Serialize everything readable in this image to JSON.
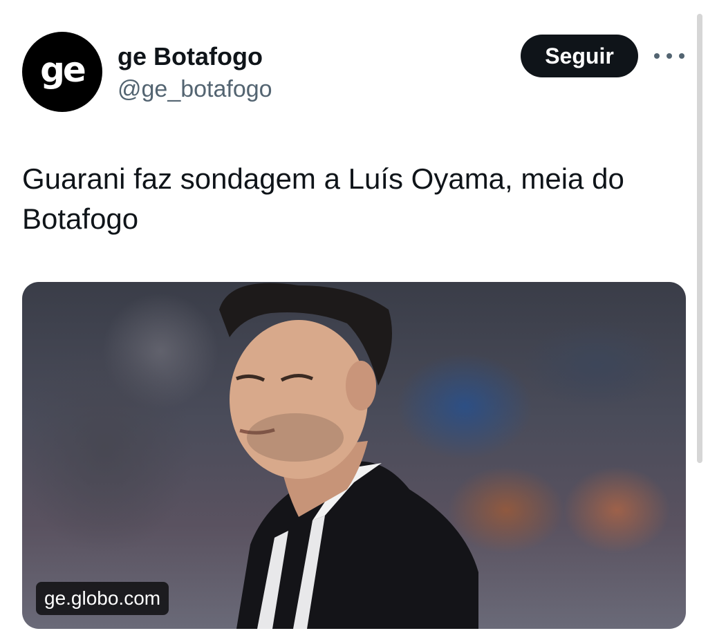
{
  "tweet": {
    "author": {
      "avatar_text": "ge",
      "display_name": "ge Botafogo",
      "handle": "@ge_botafogo"
    },
    "follow_label": "Seguir",
    "text": "Guarani faz sondagem a Luís Oyama, meia do Botafogo",
    "card": {
      "domain": "ge.globo.com",
      "image_description": "photo of football player in black and white striped jersey"
    }
  },
  "colors": {
    "text_primary": "#0f1419",
    "text_secondary": "#536471",
    "button_bg": "#0f1419",
    "button_text": "#ffffff",
    "avatar_bg": "#000000"
  },
  "icons": {
    "more": "more-horizontal-icon"
  }
}
